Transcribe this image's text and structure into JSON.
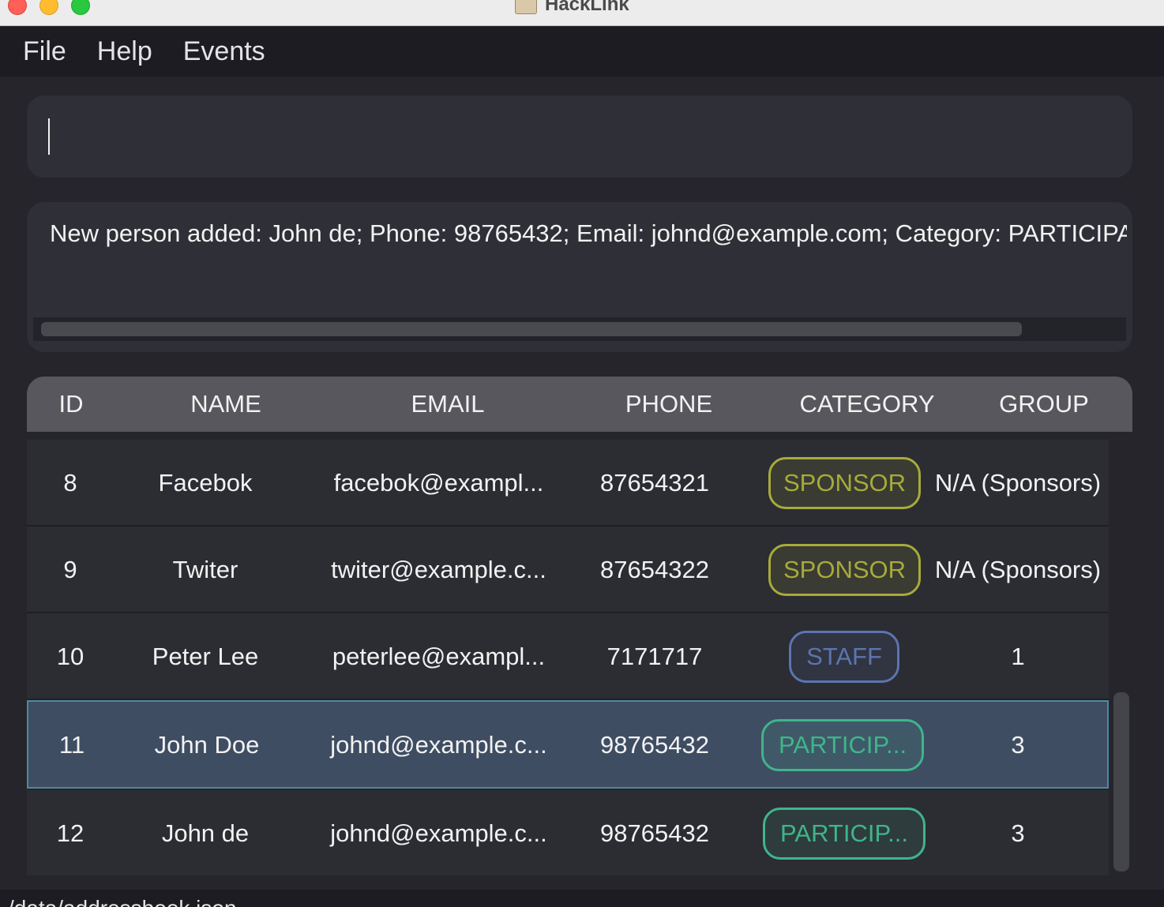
{
  "window": {
    "title": "HackLink"
  },
  "menu": {
    "file": "File",
    "help": "Help",
    "events": "Events"
  },
  "command": {
    "value": ""
  },
  "result": {
    "text": "New person added: John de; Phone: 98765432; Email: johnd@example.com; Category: PARTICIPANT"
  },
  "table": {
    "headers": {
      "id": "ID",
      "name": "NAME",
      "email": "EMAIL",
      "phone": "PHONE",
      "category": "CATEGORY",
      "group": "GROUP"
    },
    "rows": [
      {
        "id": "8",
        "name": "Facebok",
        "email": "facebok@exampl...",
        "phone": "87654321",
        "category": "SPONSOR",
        "group": "N/A (Sponsors)"
      },
      {
        "id": "9",
        "name": "Twiter",
        "email": "twiter@example.c...",
        "phone": "87654322",
        "category": "SPONSOR",
        "group": "N/A (Sponsors)"
      },
      {
        "id": "10",
        "name": "Peter Lee",
        "email": "peterlee@exampl...",
        "phone": "7171717",
        "category": "STAFF",
        "group": "1"
      },
      {
        "id": "11",
        "name": "John   Doe",
        "email": "johnd@example.c...",
        "phone": "98765432",
        "category": "PARTICIP...",
        "group": "3"
      },
      {
        "id": "12",
        "name": "John de",
        "email": "johnd@example.c...",
        "phone": "98765432",
        "category": "PARTICIP...",
        "group": "3"
      }
    ],
    "selected_row": 3
  },
  "colors": {
    "sponsor": "#a7ab3a",
    "staff": "#5b75b0",
    "participant": "#3fb58a"
  },
  "status": {
    "text": "/data/addressbook.json"
  }
}
